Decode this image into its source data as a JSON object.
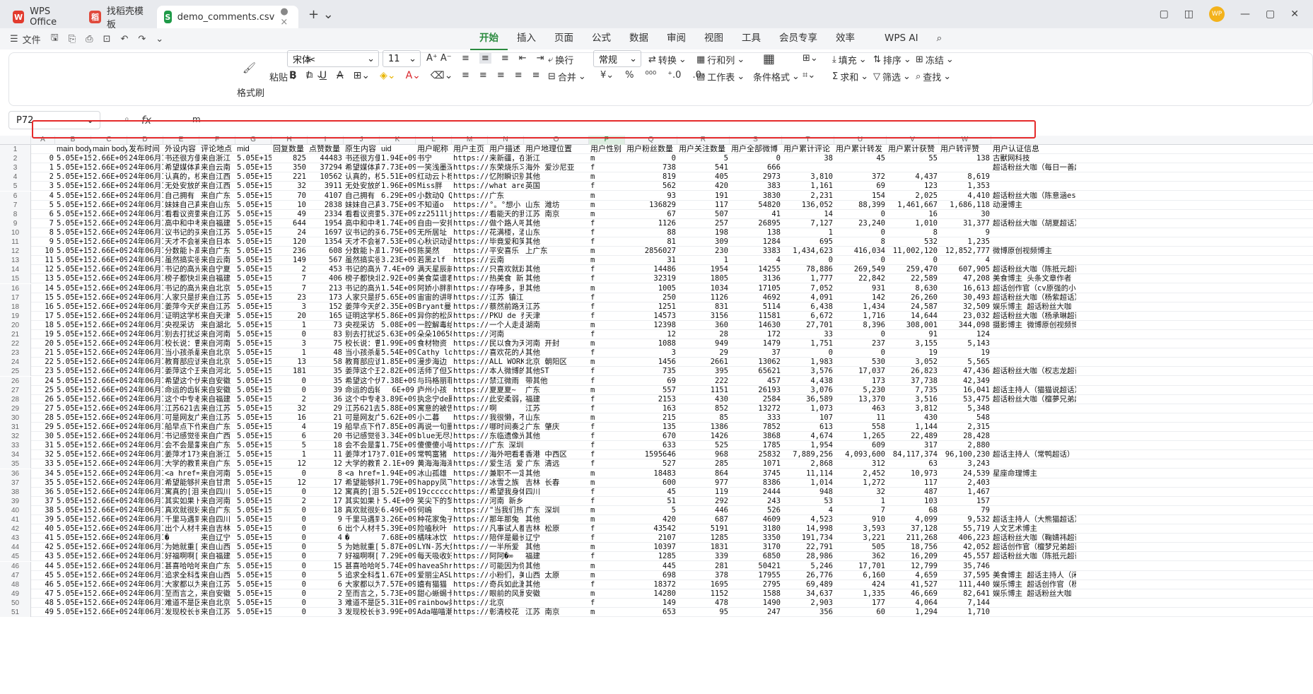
{
  "titlebar": {
    "tabs": [
      {
        "label": "WPS Office"
      },
      {
        "label": "找稻壳模板"
      },
      {
        "label": "demo_comments.csv"
      }
    ],
    "avatar": "WP"
  },
  "menubar": {
    "file": "文件",
    "tabs": [
      "开始",
      "插入",
      "页面",
      "公式",
      "数据",
      "审阅",
      "视图",
      "工具",
      "会员专享",
      "效率"
    ],
    "ai": "WPS AI"
  },
  "ribbon": {
    "format_painter": "格式刷",
    "paste": "粘贴",
    "font": "宋体",
    "size": "11",
    "wrap": "换行",
    "numfmt": "常规",
    "convert": "转换",
    "rowcol": "行和列",
    "sheet": "工作表",
    "condfmt": "条件格式",
    "fill": "填充",
    "sort": "排序",
    "freeze": "冻结",
    "sum": "求和",
    "filter": "筛选",
    "find": "查找",
    "merge": "合并"
  },
  "formula": {
    "cell": "P72",
    "value": "m"
  },
  "columns": [
    "A",
    "B",
    "C",
    "D",
    "E",
    "F",
    "G",
    "H",
    "I",
    "J",
    "K",
    "L",
    "M",
    "N",
    "O",
    "P",
    "Q",
    "R",
    "S",
    "T",
    "U",
    "V",
    "W"
  ],
  "header": [
    "",
    "main body",
    "main body",
    "发布时间",
    "外设内容",
    "评论地点",
    "mid",
    "回复数量",
    "点赞数量",
    "原生内容",
    "uid",
    "用户昵称",
    "用户主页",
    "用户描述",
    "用户地理位置",
    "用户性别",
    "用户粉丝数量",
    "用户关注数量",
    "用户全部微博",
    "用户累计评论",
    "用户累计转发",
    "用户累计获赞",
    "用户转评赞",
    "用户认证信息"
  ],
  "rows": [
    [
      "0",
      "5.05E+15",
      "2.66E+09",
      "24年06月1",
      "书还很方便",
      "来自浙江",
      "5.05E+15",
      "825",
      "44483",
      "书还很方便",
      "1.94E+09",
      "书宁",
      "https://we",
      "来新疆，在",
      "浙江",
      "m",
      "0",
      "5",
      "0",
      "38",
      "45",
      "55",
      "138",
      "古獸网科技"
    ],
    [
      "1",
      "5.05E+15",
      "2.66E+09",
      "24年06月1",
      "希望媒体真",
      "来自云南",
      "5.05E+15",
      "350",
      "37294",
      "希望媒体真",
      "7.73E+09",
      "一笑浅墨深",
      "https://we",
      "东荣烧乐习",
      "海外 爱沙尼亚",
      "f",
      "738",
      "541",
      "666",
      "",
      "",
      "",
      "",
      "超话粉丝大咖（每日一善超话）"
    ],
    [
      "2",
      "5.05E+15",
      "2.66E+09",
      "24年06月1",
      "认真的，校",
      "来自江西",
      "5.05E+15",
      "221",
      "10562",
      "认真的，校",
      "5.51E+09",
      "红动云卜栎",
      "https://we",
      "忆附瞬识别",
      "其他",
      "m",
      "819",
      "405",
      "2973",
      "3,810",
      "372",
      "4,437",
      "8,619",
      ""
    ],
    [
      "3",
      "5.05E+15",
      "2.66E+09",
      "24年06月1",
      "无处安放的",
      "来自江西",
      "5.05E+15",
      "32",
      "3911",
      "无处安放的",
      "1.96E+09",
      "Miss胖",
      "https://weibo",
      "what are",
      "英国",
      "f",
      "562",
      "420",
      "383",
      "1,161",
      "69",
      "123",
      "1,353",
      ""
    ],
    [
      "4",
      "5.05E+15",
      "2.66E+09",
      "24年06月1",
      "自己拥有",
      "来自广东",
      "5.05E+15",
      "70",
      "4107",
      "自己拥有",
      "6.29E+09",
      "小数动Q Q",
      "https://weibo.com/u/",
      "广东",
      "",
      "m",
      "93",
      "191",
      "3830",
      "2,231",
      "154",
      "2,025",
      "4,410",
      "超话粉丝大咖（陈意涵estelle超话）"
    ],
    [
      "5",
      "5.05E+15",
      "2.66E+09",
      "24年06月1",
      "妹妹自己真",
      "来自山东",
      "5.05E+15",
      "10",
      "2838",
      "妹妹自己真",
      "3.75E+09",
      "不知道o",
      "https://we",
      "°。°想小",
      "山东 潍坊",
      "m",
      "136829",
      "117",
      "54820",
      "136,052",
      "88,399",
      "1,461,667",
      "1,686,118",
      "动漫博主"
    ],
    [
      "6",
      "5.05E+15",
      "2.66E+09",
      "24年06月1",
      "看看议资要",
      "来自江苏",
      "5.05E+15",
      "49",
      "2334",
      "看看议资要",
      "5.37E+09",
      "zz2511lj",
      "https://we",
      "看能天的我",
      "江苏 南京",
      "m",
      "67",
      "507",
      "41",
      "14",
      "0",
      "16",
      "30",
      ""
    ],
    [
      "7",
      "5.05E+15",
      "2.66E+09",
      "24年06月1",
      "高中和中考",
      "来自福建",
      "5.05E+15",
      "644",
      "1954",
      "高中和中考",
      "1.74E+09",
      "自由一安排",
      "https://we",
      "做个路人吧",
      "其他",
      "f",
      "1126",
      "257",
      "26895",
      "7,127",
      "23,240",
      "1,010",
      "31,377",
      "超话粉丝大咖（胡夏超话）"
    ],
    [
      "8",
      "5.05E+15",
      "2.66E+09",
      "24年06月1",
      "议书记的买",
      "来自江苏",
      "5.05E+15",
      "24",
      "1697",
      "议书记的买",
      "6.75E+09",
      "无所居址",
      "https://we",
      "花满楼，酒",
      "山东",
      "f",
      "88",
      "198",
      "138",
      "1",
      "0",
      "8",
      "9",
      ""
    ],
    [
      "9",
      "5.05E+15",
      "2.66E+09",
      "24年06月1",
      "天才不会被",
      "来自日本",
      "5.05E+15",
      "120",
      "1354",
      "天才不会被",
      "7.53E+09",
      "心秋识动语",
      "https://we",
      "毕竟爱和笑",
      "其他",
      "f",
      "81",
      "309",
      "1284",
      "695",
      "8",
      "532",
      "1,235",
      ""
    ],
    [
      "10",
      "5.05E+15",
      "2.66E+09",
      "24年06月1",
      "分数能卜高",
      "来自广东",
      "5.05E+15",
      "236",
      "608",
      "分数能卜高",
      "1.79E+09",
      "陈昊然",
      "https://we",
      "平安喜乐",
      "上广东",
      "m",
      "2856027",
      "230",
      "3383",
      "1,434,623",
      "416,034",
      "11,002,120",
      "12,852,777",
      "微博原创视频博主"
    ],
    [
      "11",
      "5.05E+15",
      "2.66E+09",
      "24年06月1",
      "虽然搞实很",
      "来自云南",
      "5.05E+15",
      "149",
      "567",
      "虽然搞实很",
      "3.23E+09",
      "若黑zlf",
      "https://weibo.com/u/",
      "云南",
      "",
      "m",
      "31",
      "1",
      "4",
      "0",
      "0",
      "0",
      "4",
      ""
    ],
    [
      "12",
      "5.05E+15",
      "2.66E+09",
      "24年06月1",
      "书记的高光",
      "来自宁夏",
      "5.05E+15",
      "2",
      "453",
      "书记的高光",
      "7.4E+09",
      "满天星辰前",
      "https://we",
      "只喜欢就跃",
      "其他",
      "f",
      "14486",
      "1954",
      "14255",
      "78,886",
      "269,549",
      "259,470",
      "607,905",
      "超话粉丝大咖（陈抵元超话）"
    ],
    [
      "13",
      "5.05E+15",
      "2.66E+09",
      "24年06月1",
      "榜子都快北",
      "来自福建",
      "5.05E+15",
      "7",
      "406",
      "榜子都快北",
      "2.92E+09",
      "美食菜谱君",
      "https://we",
      "热美食 新",
      "其他",
      "f",
      "32319",
      "1805",
      "3136",
      "1,777",
      "22,842",
      "22,589",
      "47,208",
      "美食博主 头条文章作者"
    ],
    [
      "14",
      "5.05E+15",
      "2.66E+09",
      "24年06月1",
      "书记的高光",
      "来自北京",
      "5.05E+15",
      "7",
      "213",
      "书记的高光",
      "1.54E+09",
      "阿娇小胖胖",
      "https://we",
      "存唪多，我",
      "其他",
      "m",
      "1005",
      "1034",
      "17105",
      "7,052",
      "931",
      "8,630",
      "16,613",
      "超话创作官（cv原强的小红军超话）"
    ],
    [
      "15",
      "5.05E+15",
      "2.66E+09",
      "24年06月1",
      "人家只是挤",
      "来自江苏",
      "5.05E+15",
      "23",
      "173",
      "人家只是挤",
      "5.65E+09",
      "宙宙的讲明",
      "https://weibo.com/u/",
      "江苏 镇江",
      "",
      "f",
      "250",
      "1126",
      "4692",
      "4,091",
      "142",
      "26,260",
      "30,493",
      "超话粉丝大咖（杨紫超话）"
    ],
    [
      "16",
      "5.05E+15",
      "2.66E+09",
      "24年06月1",
      "姜萍今天的",
      "来自江苏",
      "5.05E+15",
      "3",
      "152",
      "姜萍今天的",
      "2.35E+09",
      "Bryant曼巴",
      "https://we",
      "蔡然前路无",
      "江苏",
      "f",
      "1251",
      "831",
      "5114",
      "6,438",
      "1,434",
      "24,587",
      "32,509",
      "娱乐博主 超话粉丝大咖（单依纯超话）"
    ],
    [
      "17",
      "5.05E+15",
      "2.66E+09",
      "24年06月1",
      "证明这学校",
      "来自天津",
      "5.05E+15",
      "20",
      "165",
      "证明这学校",
      "5.86E+09",
      "异你的松风",
      "https://we",
      "PKU de 乔",
      "天津",
      "f",
      "14573",
      "3156",
      "11581",
      "6,672",
      "1,716",
      "14,644",
      "23,032",
      "超话粉丝大咖（杨承琳超话）"
    ],
    [
      "18",
      "5.05E+15",
      "2.66E+09",
      "24年06月1",
      "央视采访",
      "来自湖北",
      "5.05E+15",
      "1",
      "73",
      "央视采访",
      "5.08E+09",
      "一腔解毒给",
      "https://we",
      "一个人走走",
      "湖南",
      "m",
      "12398",
      "360",
      "14630",
      "27,701",
      "8,396",
      "308,001",
      "344,098",
      "摄影博主 微博原创视频博主"
    ],
    [
      "19",
      "5.05E+15",
      "2.66E+09",
      "24年06月1",
      "别去打扰这",
      "来自河南",
      "5.05E+15",
      "0",
      "83",
      "别去打扰这",
      "5.63E+09",
      "朵朵10658",
      "https://weibo.com/u/",
      "河南",
      "",
      "f",
      "12",
      "28",
      "172",
      "33",
      "0",
      "91",
      "124",
      ""
    ],
    [
      "20",
      "5.05E+15",
      "2.66E+09",
      "24年06月1",
      "校长说：曹",
      "来自河南",
      "5.05E+15",
      "3",
      "75",
      "校长说：曹",
      "1.99E+09",
      "食材物资",
      "https://we",
      "民以食为天",
      "河南 开封",
      "m",
      "1088",
      "949",
      "1479",
      "1,751",
      "237",
      "3,155",
      "5,143",
      ""
    ],
    [
      "21",
      "5.05E+15",
      "2.66E+09",
      "24年06月1",
      "当小孩杀最",
      "来自北京",
      "5.05E+15",
      "1",
      "48",
      "当小孩杀最",
      "5.54E+09",
      "Cathy love",
      "https://we",
      "喜欢花的人",
      "其他",
      "f",
      "3",
      "29",
      "37",
      "0",
      "0",
      "19",
      "19",
      ""
    ],
    [
      "22",
      "5.05E+15",
      "2.66E+09",
      "24年06月1",
      "教育部应该",
      "来自北京",
      "5.05E+15",
      "13",
      "58",
      "教育部应该",
      "1.85E+09",
      "漫步海边",
      "https://we",
      "ALL WORK",
      "北京 朝阳区",
      "m",
      "1456",
      "2661",
      "13062",
      "1,983",
      "530",
      "3,052",
      "5,565",
      ""
    ],
    [
      "23",
      "5.05E+15",
      "2.66E+09",
      "24年06月1",
      "姜萍这个丑",
      "来自河北",
      "5.05E+15",
      "181",
      "35",
      "姜萍这个丑",
      "2.82E+09",
      "活师了但又",
      "https://we",
      "本人微博的",
      "其他ST",
      "f",
      "735",
      "395",
      "65621",
      "3,576",
      "17,037",
      "26,823",
      "47,436",
      "超话粉丝大咖（权志龙超话）"
    ],
    [
      "24",
      "5.05E+15",
      "2.66E+09",
      "24年06月1",
      "希望这个伏",
      "来自安徽",
      "5.05E+15",
      "0",
      "35",
      "希望这个伏",
      "7.38E+09",
      "与玛格丽菲",
      "https://we",
      "禁江微雨",
      "带其他",
      "f",
      "69",
      "222",
      "457",
      "4,438",
      "173",
      "37,738",
      "42,349",
      ""
    ],
    [
      "25",
      "5.05E+15",
      "2.66E+09",
      "24年06月1",
      "命运的齿轮",
      "来自安徽",
      "5.05E+15",
      "0",
      "39",
      "命运的齿轮",
      "6E+09",
      "庐州小孩",
      "https://we",
      "夏夏夏~",
      "广东",
      "m",
      "557",
      "1151",
      "26193",
      "3,076",
      "5,230",
      "7,735",
      "16,041",
      "超话主持人（猫猫说超话）"
    ],
    [
      "26",
      "5.05E+15",
      "2.66E+09",
      "24年06月1",
      "这个中专老",
      "来自福建",
      "5.05E+15",
      "2",
      "36",
      "这个中专老",
      "3.89E+09",
      "执念宁de殿",
      "https://we",
      "此安柔弱，",
      "福建",
      "f",
      "2153",
      "430",
      "2584",
      "36,589",
      "13,370",
      "3,516",
      "53,475",
      "超话粉丝大咖（檀夢兄弟超话）"
    ],
    [
      "27",
      "5.05E+15",
      "2.66E+09",
      "24年06月1",
      "江苏621去",
      "来自江苏",
      "5.05E+15",
      "32",
      "29",
      "江苏621去",
      "5.88E+09",
      "寓意的被告",
      "https://we",
      "啊",
      "江苏",
      "f",
      "163",
      "852",
      "13272",
      "1,073",
      "463",
      "3,812",
      "5,348",
      ""
    ],
    [
      "28",
      "5.05E+15",
      "2.66E+09",
      "24年06月1",
      "可是网友广",
      "来自江苏",
      "5.05E+15",
      "16",
      "21",
      "可是网友广",
      "5.62E+09",
      "小二暮",
      "https://we",
      "我很懒，不",
      "山东",
      "m",
      "215",
      "85",
      "333",
      "107",
      "11",
      "430",
      "548",
      ""
    ],
    [
      "29",
      "5.05E+15",
      "2.66E+09",
      "24年06月1",
      "船早点下作",
      "来自广东",
      "5.05E+15",
      "4",
      "19",
      "船早点下作",
      "7.85E+09",
      "再说一句删",
      "https://we",
      "哪时间奏之",
      "广东 肇庆",
      "f",
      "135",
      "1386",
      "7852",
      "613",
      "558",
      "1,144",
      "2,315",
      ""
    ],
    [
      "30",
      "5.05E+15",
      "2.66E+09",
      "24年06月1",
      "书记感觉很",
      "来自广西",
      "5.05E+15",
      "6",
      "20",
      "书记感觉很",
      "3.34E+09",
      "blue无尽夏",
      "https://we",
      "东临遗像光",
      "其他",
      "f",
      "670",
      "1426",
      "3868",
      "4,674",
      "1,265",
      "22,489",
      "28,428",
      ""
    ],
    [
      "31",
      "5.05E+15",
      "2.66E+09",
      "24年06月1",
      "会不会是蒙",
      "来自广东",
      "5.05E+15",
      "5",
      "18",
      "会不会是蒙",
      "1.75E+09",
      "傻傻傻小喵",
      "https://weibo.com/u/",
      "广东 深圳",
      "",
      "f",
      "633",
      "525",
      "1785",
      "1,954",
      "609",
      "317",
      "2,880",
      ""
    ],
    [
      "32",
      "5.05E+15",
      "2.66E+09",
      "24年06月1",
      "姜萍才17岁",
      "来自浙江",
      "5.05E+15",
      "1",
      "11",
      "姜萍才17岁",
      "7.01E+09",
      "常鸭富猪",
      "https://we",
      "海外吧看看",
      "香港 中西区",
      "f",
      "1595646",
      "968",
      "25832",
      "7,889,256",
      "4,093,600",
      "84,117,374",
      "96,100,230",
      "超话主持人（常鸭超话）"
    ],
    [
      "33",
      "5.05E+15",
      "2.66E+09",
      "24年06月1",
      "大学的教育",
      "来自广东",
      "5.05E+15",
      "12",
      "12",
      "大学的教育",
      "2.1E+09",
      "黄海海海海",
      "https://we",
      "爱生活 爱",
      "广东 清远",
      "f",
      "527",
      "285",
      "1071",
      "2,868",
      "312",
      "63",
      "3,243",
      ""
    ],
    [
      "34",
      "5.05E+15",
      "2.66E+09",
      "24年06月1",
      "<a href=\"",
      "来自河南",
      "5.05E+15",
      "0",
      "8",
      "<a href=\"",
      "1.94E+09",
      "冰山孤雄",
      "https://we",
      "兼职不一定",
      "其他",
      "m",
      "18483",
      "864",
      "3745",
      "11,114",
      "2,452",
      "10,973",
      "24,539",
      "星座命理博主"
    ],
    [
      "35",
      "5.05E+15",
      "2.66E+09",
      "24年06月1",
      "希望能够持",
      "来自甘肃",
      "5.05E+15",
      "12",
      "17",
      "希望能够持",
      "1.79E+09",
      "happy凤飞",
      "https://we",
      "冰雪之族",
      "吉林 长春",
      "m",
      "600",
      "977",
      "8386",
      "1,014",
      "1,272",
      "117",
      "2,403",
      ""
    ],
    [
      "36",
      "5.05E+15",
      "2.66E+09",
      "24年06月1",
      "寓真的[泪]",
      "来自四川",
      "5.05E+15",
      "0",
      "12",
      "寓真的[泪]",
      "5.52E+09",
      "19cccccccc",
      "https://we",
      "希望我身体",
      "四川",
      "f",
      "45",
      "119",
      "2444",
      "948",
      "32",
      "487",
      "1,467",
      ""
    ],
    [
      "37",
      "5.05E+15",
      "2.66E+09",
      "24年06月1",
      "其实如果卜",
      "来自河南",
      "5.05E+15",
      "2",
      "17",
      "其实如果卜",
      "5.4E+09",
      "笑尖下的梦",
      "https://weibo.com/u/",
      "河南 新乡",
      "",
      "f",
      "51",
      "292",
      "243",
      "53",
      "1",
      "103",
      "157",
      ""
    ],
    [
      "38",
      "5.05E+15",
      "2.66E+09",
      "24年06月1",
      "真欢就很好",
      "来自广东",
      "5.05E+15",
      "0",
      "18",
      "真欢就很好",
      "6.49E+09",
      "何嶋",
      "https://we",
      "\"当我们热",
      "广东 深圳",
      "m",
      "5",
      "446",
      "526",
      "4",
      "7",
      "68",
      "79",
      ""
    ],
    [
      "39",
      "5.05E+15",
      "2.66E+09",
      "24年06月1",
      "千里马遇到",
      "来自四川",
      "5.05E+15",
      "0",
      "9",
      "千里马遇到",
      "3.26E+09",
      "种花家兔子",
      "https://we",
      "那年那兔",
      "其他",
      "m",
      "420",
      "687",
      "4609",
      "4,523",
      "910",
      "4,099",
      "9,532",
      "超话主持人（大熊猫超话）"
    ],
    [
      "40",
      "5.05E+15",
      "2.66E+09",
      "24年06月1",
      "出个人材书",
      "来自吉林",
      "5.05E+15",
      "0",
      "6",
      "出个人材书",
      "5.39E+09",
      "险嗑秋叶",
      "https://we",
      "凡事试人都",
      "吉林 松原",
      "f",
      "43542",
      "5191",
      "3180",
      "14,998",
      "3,593",
      "37,128",
      "55,719",
      "人文艺术博主"
    ],
    [
      "41",
      "5.05E+15",
      "2.66E+09",
      "24年06月1",
      "�",
      "来自辽宁",
      "5.05E+15",
      "0",
      "4",
      "�",
      "7.68E+09",
      "橘味冰饮",
      "https://we",
      "陪伴是最长",
      "辽宁",
      "f",
      "2107",
      "1285",
      "3350",
      "191,734",
      "3,221",
      "211,268",
      "406,223",
      "超话粉丝大咖（鞠婧祎超话）"
    ],
    [
      "42",
      "5.05E+15",
      "2.66E+09",
      "24年06月1",
      "为她就重[",
      "来自山西",
      "5.05E+15",
      "0",
      "5",
      "为她就重[",
      "5.87E+09",
      "LYN-苏大娟",
      "https://we",
      "一半所爱",
      "其他",
      "m",
      "10397",
      "1831",
      "3170",
      "22,791",
      "505",
      "18,756",
      "42,052",
      "超话创作官（檀梦兄弟超话）"
    ],
    [
      "43",
      "5.05E+15",
      "2.66E+09",
      "24年06月1",
      "好福啊啊[",
      "来自福建",
      "5.05E+15",
      "0",
      "7",
      "好福啊啊[",
      "7.29E+09",
      "每天吸收好",
      "https://we",
      "阿阿�∞",
      "福建",
      "f",
      "1285",
      "339",
      "6850",
      "28,986",
      "362",
      "16,209",
      "45,557",
      "超话粉丝大咖（陈抵元超话）"
    ],
    [
      "44",
      "5.05E+15",
      "2.66E+09",
      "24年06月1",
      "甚喜哈哈哈",
      "来自广东",
      "5.05E+15",
      "0",
      "15",
      "甚喜哈哈哈",
      "5.74E+09",
      "haveaShrrt",
      "https://we",
      "可能因为你",
      "其他",
      "m",
      "445",
      "281",
      "50421",
      "5,246",
      "17,701",
      "12,799",
      "35,746",
      ""
    ],
    [
      "45",
      "5.05E+15",
      "2.66E+09",
      "24年06月1",
      "追求全科型",
      "来自山西",
      "5.05E+15",
      "0",
      "5",
      "追求全科型",
      "1.67E+09",
      "爱丽尘ASL",
      "https://we",
      "小粉们，美",
      "山西 太原",
      "m",
      "698",
      "378",
      "17955",
      "26,776",
      "6,160",
      "4,659",
      "37,595",
      "美食博主 超话主持人（闲关之宇宙超话）"
    ],
    [
      "46",
      "5.05E+15",
      "2.66E+09",
      "24年06月1",
      "大家都以为",
      "来自江苏",
      "5.05E+15",
      "0",
      "6",
      "大家都以为",
      "7.57E+09",
      "嬉有猫猫",
      "https://we",
      "奇兵如此激",
      "其他",
      "f",
      "18372",
      "1695",
      "2795",
      "69,489",
      "424",
      "41,527",
      "111,440",
      "娱乐博主 超话创作官（杨紫超话）"
    ],
    [
      "47",
      "5.05E+15",
      "2.66E+09",
      "24年06月1",
      "至而言之，",
      "来自安徽",
      "5.05E+15",
      "0",
      "2",
      "至而言之，",
      "5.73E+09",
      "甜心蜥蜴卡",
      "https://we",
      "眼前的风景",
      "安徽",
      "m",
      "14280",
      "1152",
      "1588",
      "34,637",
      "1,335",
      "46,669",
      "82,641",
      "娱乐博主 超话粉丝大咖（于心凌超话）"
    ],
    [
      "48",
      "5.05E+15",
      "2.66E+09",
      "24年06月1",
      "难道不是区",
      "来自北京",
      "5.05E+15",
      "0",
      "3",
      "难道不是区",
      "5.31E+09",
      "rainbow弟弟",
      "https://weibo.com/u/",
      "北京",
      "",
      "f",
      "149",
      "478",
      "1490",
      "2,903",
      "177",
      "4,064",
      "7,144",
      ""
    ],
    [
      "49",
      "5.05E+15",
      "2.66E+09",
      "24年06月1",
      "发现校长长",
      "来自江苏",
      "5.05E+15",
      "0",
      "3",
      "发现校长长",
      "3.99E+09",
      "Ada喵喵潮",
      "https://we",
      "彰清校花",
      "江苏 南京",
      "m",
      "653",
      "95",
      "247",
      "356",
      "60",
      "1,294",
      "1,710",
      ""
    ]
  ]
}
